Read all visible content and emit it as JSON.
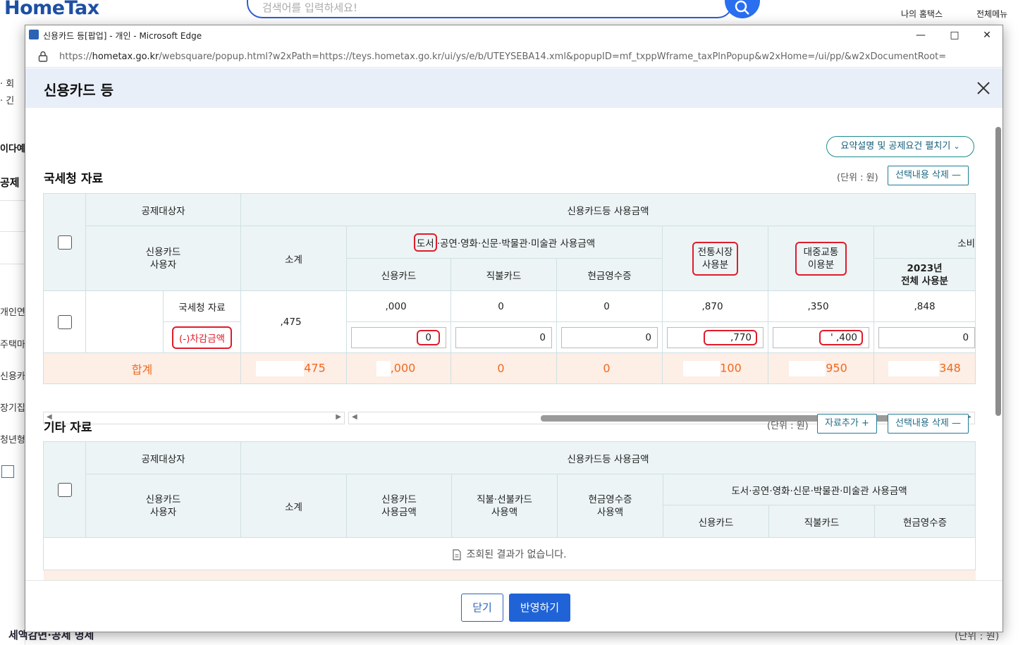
{
  "background": {
    "logo": "HomeTax",
    "search_placeholder": "검색어를 입력하세요!",
    "my_hometax": "나의 홈택스",
    "all_menu": "전체메뉴",
    "left_items": [
      "· 회",
      "· 긴",
      "이다예",
      "공제",
      "개인연",
      "주택마",
      "신용카",
      "장기집",
      "청년형"
    ],
    "bottom_text": "세액감면·공제 명세",
    "bottom_unit": "(단위 : 원)"
  },
  "window": {
    "title": "신용카드 등[팝업] - 개인 - Microsoft Edge",
    "url_prefix": "https://",
    "url_host": "hometax.go.kr",
    "url_path": "/websquare/popup.html?w2xPath=https://teys.hometax.go.kr/ui/ys/e/b/UTEYSEBA14.xml&popupID=mf_txppWframe_taxPlnPopup&w2xHome=/ui/pp/&w2xDocumentRoot="
  },
  "popup": {
    "title": "신용카드 등",
    "summary_button": "요약설명 및 공제요건 펼치기",
    "section1": {
      "title": "국세청 자료",
      "unit": "(단위 : 원)",
      "delete_button": "선택내용 삭제",
      "headers": {
        "deductee": "공제대상자",
        "card_usage_amount": "신용카드등 사용금액",
        "card_user": "신용카드\n사용자",
        "subtotal": "소계",
        "books_group": "도서·공연·영화·신문·박물관·미술관 사용금액",
        "books_word": "도서",
        "books_rest": "·공연·영화·신문·박물관·미술관 사용금액",
        "traditional_market": "전통시장\n사용분",
        "public_transport": "대중교통\n이용분",
        "consumption": "소비",
        "credit_card": "신용카드",
        "debit_card": "직불카드",
        "cash_receipt": "현금영수증",
        "year_total": "2023년\n전체 사용분"
      },
      "rows": {
        "nts_label": "국세청 자료",
        "deduction_label": "(-)차감금액",
        "nts_values": [
          ",475",
          ",000",
          "0",
          "0",
          ",870",
          ",350",
          ",848"
        ],
        "deduction_values": [
          "0",
          "0",
          "0",
          ",770",
          "' ,400",
          "0"
        ],
        "sum_label": "합계",
        "sum_values": [
          "475",
          ",000",
          "0",
          "0",
          "100",
          "950",
          "348"
        ]
      }
    },
    "section2": {
      "title": "기타 자료",
      "unit": "(단위 : 원)",
      "add_button": "자료추가",
      "delete_button": "선택내용 삭제",
      "headers": {
        "deductee": "공제대상자",
        "card_usage_amount": "신용카드등 사용금액",
        "card_user": "신용카드\n사용자",
        "subtotal": "소계",
        "credit_card_amount": "신용카드\n사용금액",
        "debit_prepaid_amount": "직불·선불카드\n사용액",
        "cash_receipt_amount": "현금영수증\n사용액",
        "books_group": "도서·공연·영화·신문·박물관·미술관 사용금액",
        "credit_card": "신용카드",
        "debit_card": "직불카드",
        "cash_receipt": "현금영수증"
      },
      "empty_message": "조회된 결과가 없습니다."
    },
    "close_button": "닫기",
    "apply_button": "반영하기"
  }
}
